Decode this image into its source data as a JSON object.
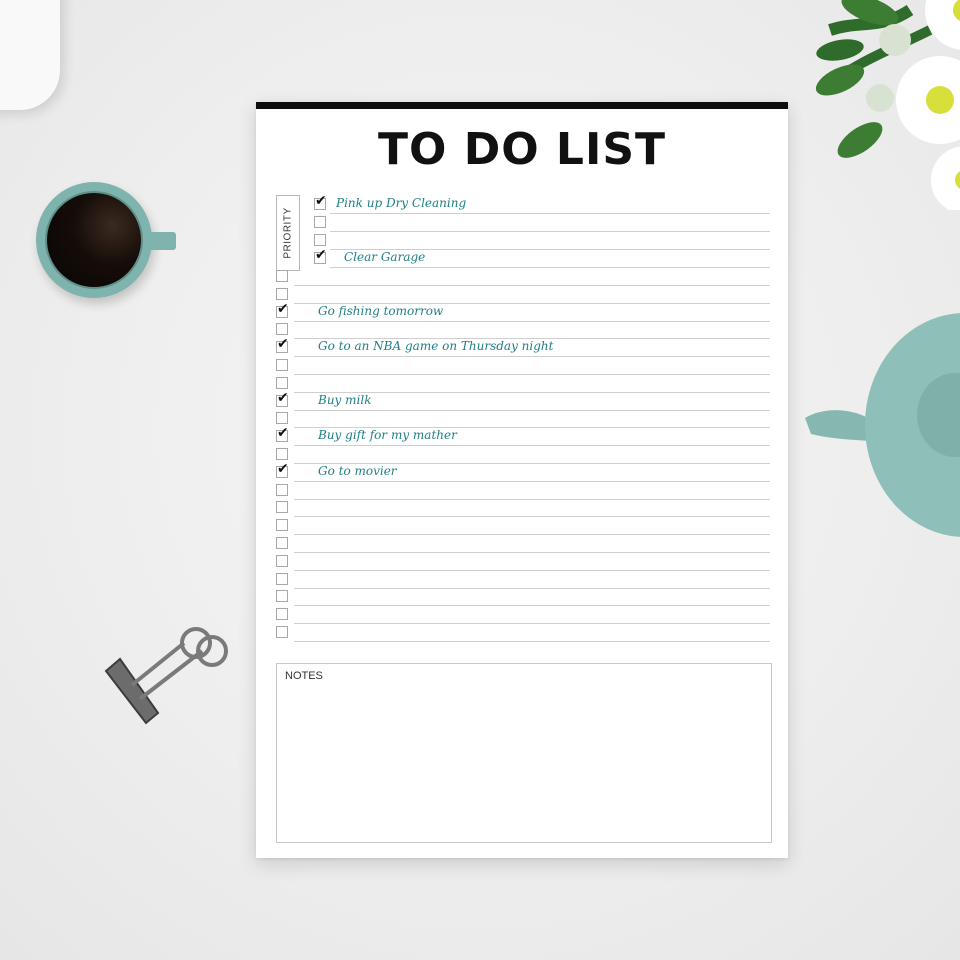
{
  "todo": {
    "title": "TO DO LIST",
    "priority_label": "PRIORITY",
    "notes_label": "NOTES",
    "ink_color": "#1f7f86",
    "priority_items": [
      {
        "text": "Pink up Dry Cleaning",
        "checked": true
      },
      {
        "text": "",
        "checked": false
      },
      {
        "text": "",
        "checked": false
      },
      {
        "text": "Clear Garage",
        "checked": true
      }
    ],
    "items": [
      {
        "text": "",
        "checked": false
      },
      {
        "text": "",
        "checked": false
      },
      {
        "text": "Go fishing tomorrow",
        "checked": true
      },
      {
        "text": "",
        "checked": false
      },
      {
        "text": "Go to an NBA game on Thursday night",
        "checked": true
      },
      {
        "text": "",
        "checked": false
      },
      {
        "text": "",
        "checked": false
      },
      {
        "text": "Buy milk",
        "checked": true
      },
      {
        "text": "",
        "checked": false
      },
      {
        "text": "Buy gift for my mather",
        "checked": true
      },
      {
        "text": "",
        "checked": false
      },
      {
        "text": "Go to movier",
        "checked": true
      },
      {
        "text": "",
        "checked": false
      },
      {
        "text": "",
        "checked": false
      },
      {
        "text": "",
        "checked": false
      },
      {
        "text": "",
        "checked": false
      },
      {
        "text": "",
        "checked": false
      },
      {
        "text": "",
        "checked": false
      },
      {
        "text": "",
        "checked": false
      },
      {
        "text": "",
        "checked": false
      },
      {
        "text": "",
        "checked": false
      }
    ]
  },
  "scene": {
    "objects": [
      "laptop-corner",
      "coffee-cup",
      "binder-clip",
      "teapot",
      "daisy-flowers"
    ]
  }
}
